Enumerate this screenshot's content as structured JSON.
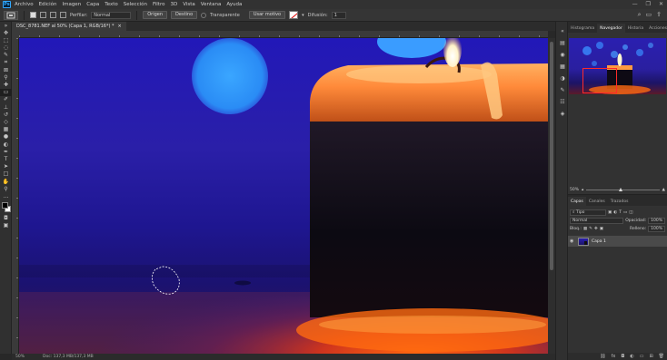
{
  "menu": {
    "logo": "Ps",
    "items": [
      "Archivo",
      "Edición",
      "Imagen",
      "Capa",
      "Texto",
      "Selección",
      "Filtro",
      "3D",
      "Vista",
      "Ventana",
      "Ayuda"
    ],
    "window_controls": [
      "—",
      "❐",
      "✕"
    ]
  },
  "options": {
    "feather_label": "Perfilar:",
    "feather_value": "Normal",
    "origin_button": "Origen",
    "dest_button": "Destino",
    "transparent_label": "Transparente",
    "use_pattern_button": "Usar motivo",
    "diffusion_label": "Difusión:",
    "diffusion_value": "1"
  },
  "document": {
    "tab_title": "DSC_8781.NEF al 50% (Capa 1, RGB/16*) *",
    "close": "×"
  },
  "status": {
    "zoom": "50%",
    "doc_size": "Doc: 137,3 MB/137,3 MB"
  },
  "panels": {
    "top_tabs": [
      "Histograma",
      "Navegador",
      "Historia",
      "Acciones"
    ],
    "active_top_tab": "Navegador",
    "nav_zoom": "50%",
    "layer_tabs": [
      "Capas",
      "Canales",
      "Trazados"
    ],
    "filter_label": "Tipo",
    "blend_mode": "Normal",
    "opacity_label": "Opacidad:",
    "opacity_value": "100%",
    "lock_label": "Bloq.:",
    "fill_label": "Relleno:",
    "fill_value": "100%",
    "layer_name": "Capa 1"
  },
  "tools": [
    "move",
    "marquee",
    "lasso",
    "quick-select",
    "crop",
    "frame",
    "eyedropper",
    "healing",
    "brush",
    "clone-stamp",
    "history-brush",
    "eraser",
    "gradient",
    "blur",
    "dodge",
    "pen",
    "text",
    "path-select",
    "rectangle",
    "hand",
    "zoom",
    "edit-toolbar"
  ]
}
